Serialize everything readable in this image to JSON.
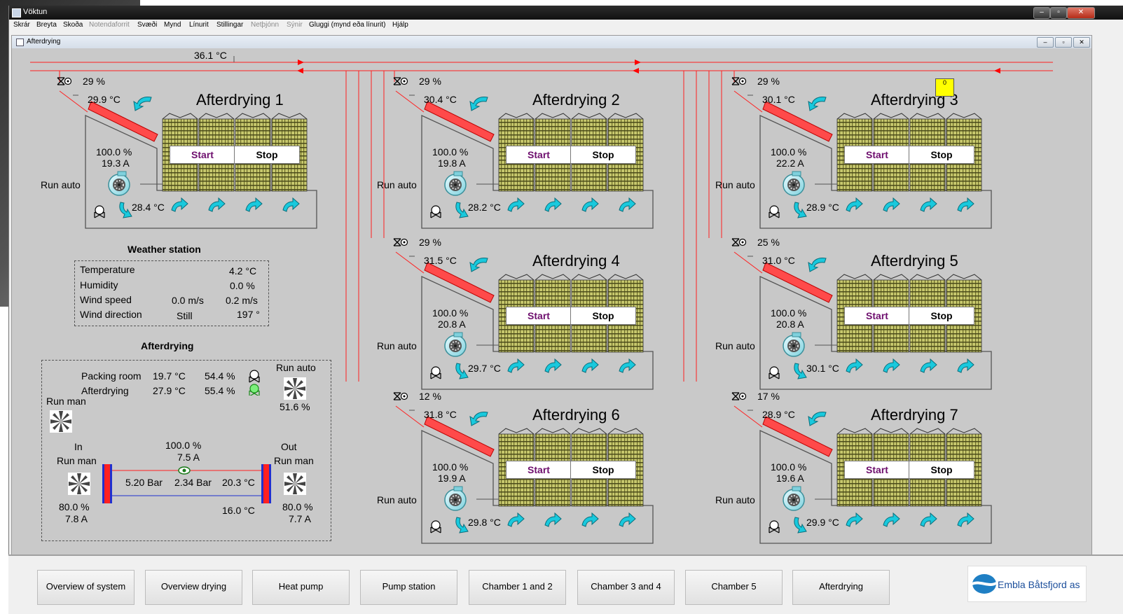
{
  "window": {
    "title": "Vöktun",
    "controls": [
      "–",
      "▫",
      "✕"
    ]
  },
  "menu": [
    {
      "label": "Skrár",
      "enabled": true
    },
    {
      "label": "Breyta",
      "enabled": true
    },
    {
      "label": "Skoða",
      "enabled": true
    },
    {
      "label": "Notendaforrit",
      "enabled": false
    },
    {
      "label": "Svæði",
      "enabled": true
    },
    {
      "label": "Mynd",
      "enabled": true
    },
    {
      "label": "Línurit",
      "enabled": true
    },
    {
      "label": "Stillingar",
      "enabled": true
    },
    {
      "label": "Netþjónn",
      "enabled": false
    },
    {
      "label": "Sýnir",
      "enabled": false
    },
    {
      "label": "Gluggi (mynd eða línurit)",
      "enabled": true
    },
    {
      "label": "Hjálp",
      "enabled": true
    }
  ],
  "subwindow": {
    "title": "Afterdrying"
  },
  "header_temp": "36.1 °C",
  "alarm_badge": "0",
  "chambers": [
    {
      "title": "Afterdrying 1",
      "valve": "29 %",
      "supply_temp": "29.9 °C",
      "fan_pct": "100.0 %",
      "fan_amp": "19.3 A",
      "mode": "Run auto",
      "return_temp": "28.4 °C",
      "start": "Start",
      "stop": "Stop"
    },
    {
      "title": "Afterdrying 2",
      "valve": "29 %",
      "supply_temp": "30.4 °C",
      "fan_pct": "100.0 %",
      "fan_amp": "19.8 A",
      "mode": "Run auto",
      "return_temp": "28.2 °C",
      "start": "Start",
      "stop": "Stop"
    },
    {
      "title": "Afterdrying 3",
      "valve": "29 %",
      "supply_temp": "30.1 °C",
      "fan_pct": "100.0 %",
      "fan_amp": "22.2 A",
      "mode": "Run auto",
      "return_temp": "28.9 °C",
      "start": "Start",
      "stop": "Stop"
    },
    {
      "title": "Afterdrying 4",
      "valve": "29 %",
      "supply_temp": "31.5 °C",
      "fan_pct": "100.0 %",
      "fan_amp": "20.8 A",
      "mode": "Run auto",
      "return_temp": "29.7 °C",
      "start": "Start",
      "stop": "Stop"
    },
    {
      "title": "Afterdrying 5",
      "valve": "25 %",
      "supply_temp": "31.0 °C",
      "fan_pct": "100.0 %",
      "fan_amp": "20.8 A",
      "mode": "Run auto",
      "return_temp": "30.1 °C",
      "start": "Start",
      "stop": "Stop"
    },
    {
      "title": "Afterdrying 6",
      "valve": "12 %",
      "supply_temp": "31.8 °C",
      "fan_pct": "100.0 %",
      "fan_amp": "19.9 A",
      "mode": "Run auto",
      "return_temp": "29.8 °C",
      "start": "Start",
      "stop": "Stop"
    },
    {
      "title": "Afterdrying 7",
      "valve": "17 %",
      "supply_temp": "28.9 °C",
      "fan_pct": "100.0 %",
      "fan_amp": "19.6 A",
      "mode": "Run auto",
      "return_temp": "29.9 °C",
      "start": "Start",
      "stop": "Stop"
    }
  ],
  "weather": {
    "title": "Weather station",
    "rows": [
      {
        "label": "Temperature",
        "v1": "",
        "v2": "4.2 °C"
      },
      {
        "label": "Humidity",
        "v1": "",
        "v2": "0.0 %"
      },
      {
        "label": "Wind speed",
        "v1": "0.0 m/s",
        "v2": "0.2 m/s"
      },
      {
        "label": "Wind direction",
        "v1": "Still",
        "v2": "197 °"
      }
    ]
  },
  "afterdrying": {
    "title": "Afterdrying",
    "packing_label": "Packing room",
    "packing_temp": "19.7 °C",
    "packing_hum": "54.4 %",
    "ad_label": "Afterdrying",
    "ad_temp": "27.9 °C",
    "ad_hum": "55.4 %",
    "fan_top_mode": "Run auto",
    "fan_top_pct": "51.6 %",
    "fan_left_mode": "Run man",
    "in_label": "In",
    "in_mode": "Run man",
    "in_pct": "80.0 %",
    "in_amp": "7.8 A",
    "out_label": "Out",
    "out_mode": "Run man",
    "out_pct": "80.0 %",
    "out_amp": "7.7 A",
    "pump_pct": "100.0 %",
    "pump_amp": "7.5 A",
    "p1": "5.20 Bar",
    "p2": "2.34 Bar",
    "t1": "20.3 °C",
    "t2": "16.0 °C"
  },
  "nav": [
    "Overview of system",
    "Overview drying",
    "Heat pump",
    "Pump station",
    "Chamber 1 and 2",
    "Chamber 3 and 4",
    "Chamber 5",
    "Afterdrying"
  ],
  "logo": "Embla Båtsfjord as"
}
